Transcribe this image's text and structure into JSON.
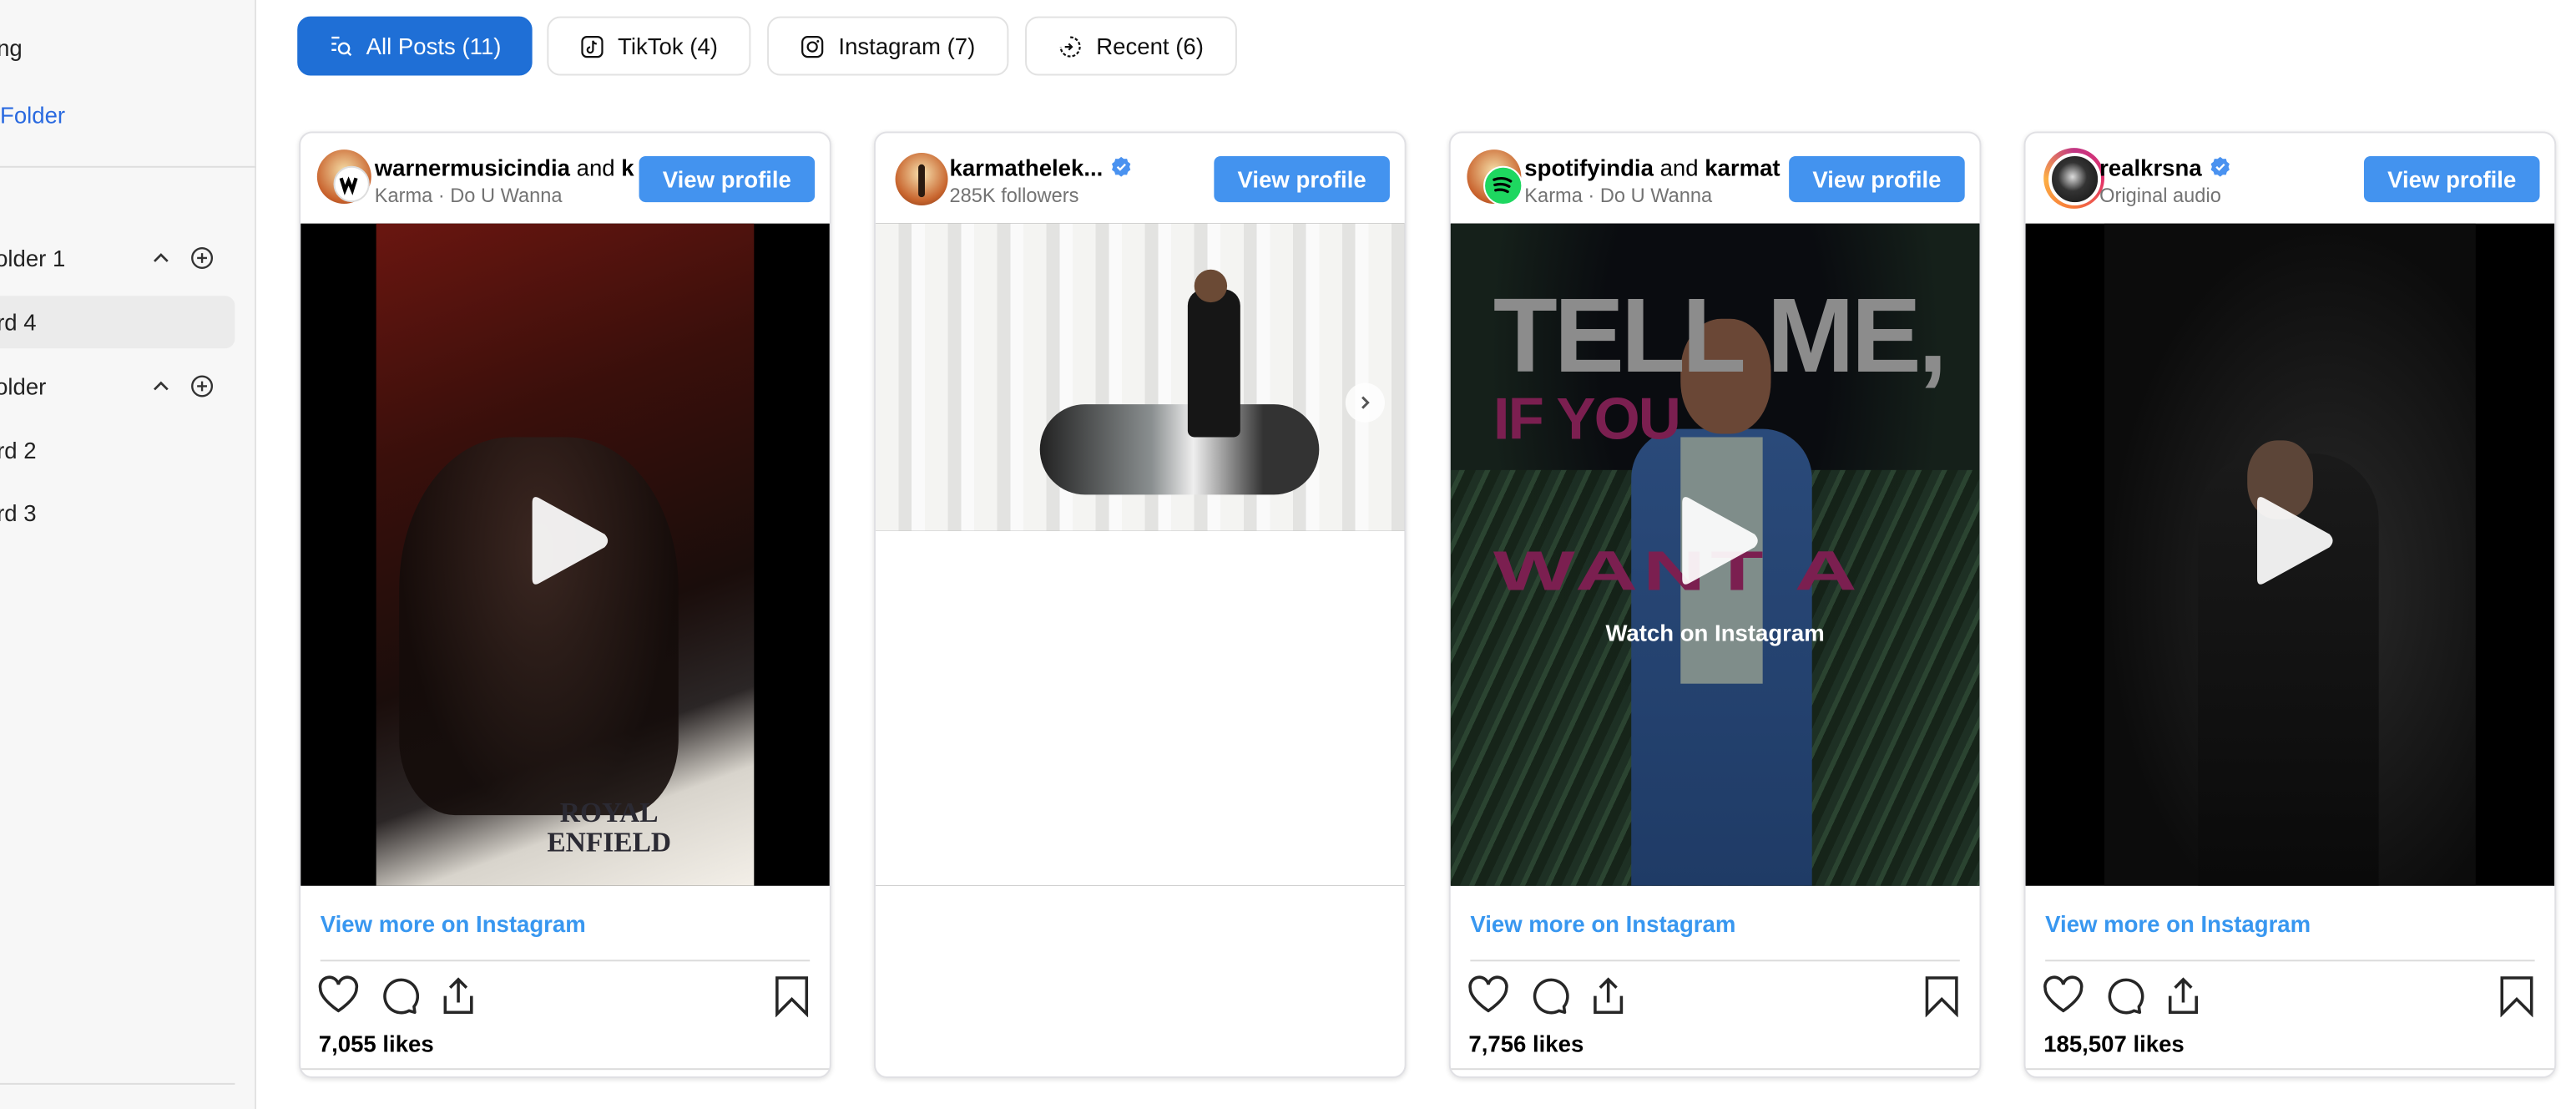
{
  "sidebar": {
    "items": [
      {
        "label": "ng"
      },
      {
        "label": "Folder"
      },
      {
        "label": "older 1"
      },
      {
        "label": "rd 4"
      },
      {
        "label": "older"
      },
      {
        "label": "rd 2"
      },
      {
        "label": "rd 3"
      }
    ]
  },
  "tabs": [
    {
      "label": "All Posts (11)",
      "icon": "list-search-icon",
      "active": true
    },
    {
      "label": "TikTok (4)",
      "icon": "tiktok-icon"
    },
    {
      "label": "Instagram (7)",
      "icon": "instagram-icon"
    },
    {
      "label": "Recent (6)",
      "icon": "recent-icon"
    }
  ],
  "colors": {
    "accent": "#1f6fd6",
    "view_profile": "#4393ef",
    "link": "#3897f0"
  },
  "cards": [
    {
      "name": "warnermusicindia",
      "and": " and ",
      "name2": "k",
      "verified": false,
      "subtitle": "Karma · Do U Wanna",
      "button": "View profile",
      "media": "video",
      "media_text": [
        "ROYAL",
        "ENFIELD"
      ],
      "view_more": "View more on Instagram",
      "likes": "7,055 likes"
    },
    {
      "name": "karmathelek...",
      "verified": true,
      "subtitle": "285K followers",
      "button": "View profile",
      "media": "carousel"
    },
    {
      "name": "spotifyindia",
      "and": " and ",
      "name2": "karmat",
      "verified": false,
      "subtitle": "Karma · Do U Wanna",
      "button": "View profile",
      "media": "video",
      "media_text": [
        "TELL ME,",
        "IF YOU",
        "WANT A"
      ],
      "watch": "Watch on Instagram",
      "view_more": "View more on Instagram",
      "likes": "7,756 likes"
    },
    {
      "name": "realkrsna",
      "verified": true,
      "subtitle": "Original audio",
      "button": "View profile",
      "media": "video",
      "view_more": "View more on Instagram",
      "likes": "185,507 likes"
    }
  ]
}
